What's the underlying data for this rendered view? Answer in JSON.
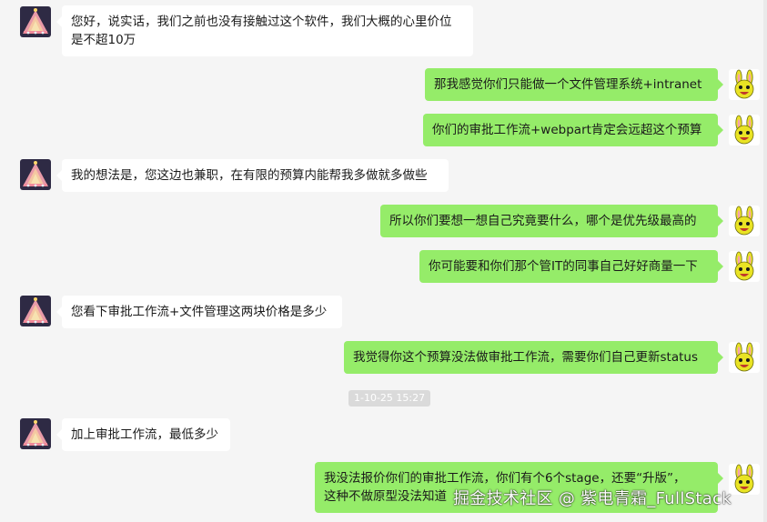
{
  "chat": {
    "messages": [
      {
        "side": "in",
        "text": "您好，说实话，我们之前也没有接触过这个软件，我们大概的心里价位\n是不超10万"
      },
      {
        "side": "out",
        "text": "那我感觉你们只能做一个文件管理系统+intranet"
      },
      {
        "side": "out",
        "text": "你们的审批工作流+webpart肯定会远超这个预算"
      },
      {
        "side": "in",
        "text": "我的想法是，您这边也兼职，在有限的预算内能帮我多做就多做些"
      },
      {
        "side": "out",
        "text": "所以你们要想一想自己究竟要什么，哪个是优先级最高的"
      },
      {
        "side": "out",
        "text": "你可能要和你们那个管IT的同事自己好好商量一下"
      },
      {
        "side": "in",
        "text": "您看下审批工作流+文件管理这两块价格是多少"
      },
      {
        "side": "out",
        "text": "我觉得你这个预算没法做审批工作流，需要你们自己更新status"
      },
      {
        "side": "in",
        "text": "加上审批工作流，最低多少"
      },
      {
        "side": "out",
        "text": "我没法报价你们的审批工作流，你们有个6个stage，还要“升版”，\n这种不做原型没法知道"
      }
    ],
    "timestamp": "1-10-25 15:27"
  },
  "watermark": "掘金技术社区 @ 紫电青霜_FullStack",
  "icons": {
    "contact_avatar": "triangle-pattern-avatar",
    "self_avatar": "yellow-bunny-avatar"
  },
  "colors": {
    "background": "#f5f5f5",
    "incoming_bubble": "#ffffff",
    "outgoing_bubble": "#95ec69",
    "timestamp_bg": "#dadada"
  }
}
